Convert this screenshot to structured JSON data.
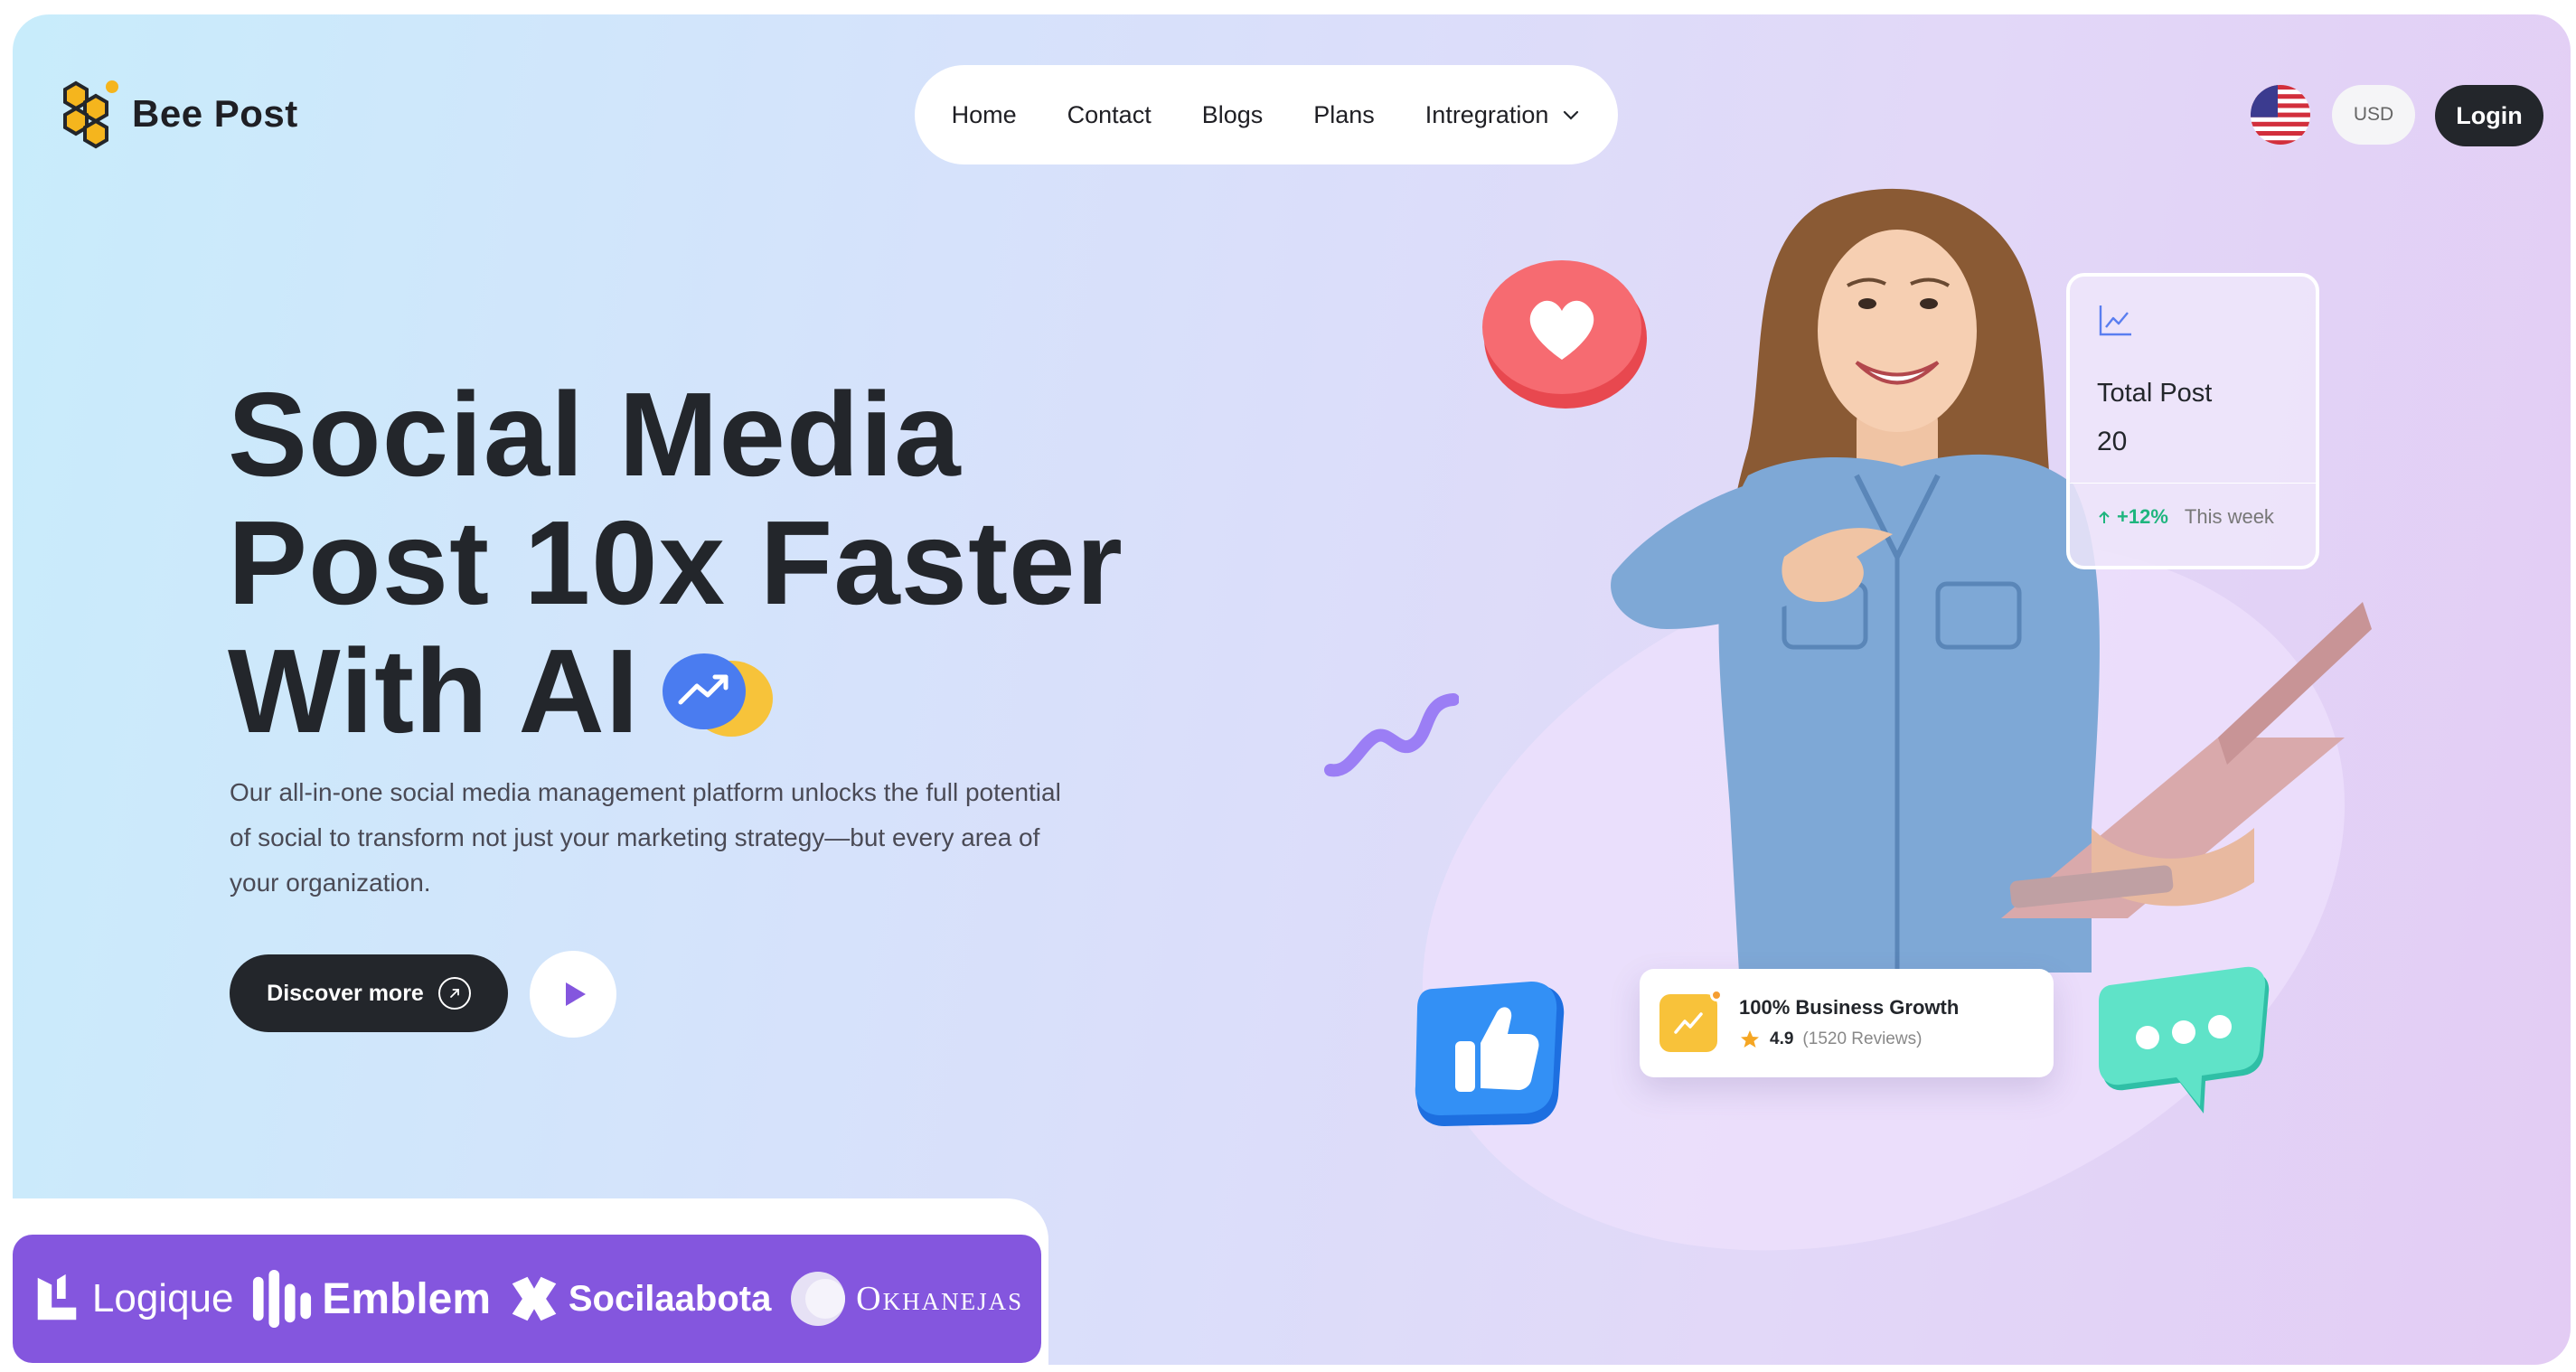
{
  "brand": {
    "name": "Bee Post",
    "colors": {
      "accent_purple": "#8456de",
      "dark": "#23262b",
      "honey": "#f5b51d",
      "growth_green": "#1fb57e"
    }
  },
  "nav": {
    "items": [
      {
        "label": "Home"
      },
      {
        "label": "Contact"
      },
      {
        "label": "Blogs"
      },
      {
        "label": "Plans"
      },
      {
        "label": "Intregration",
        "has_dropdown": true
      }
    ]
  },
  "header": {
    "flag_icon": "us-flag-icon",
    "currency": "USD",
    "login_label": "Login"
  },
  "hero": {
    "headline_lines": [
      "Social Media",
      "Post 10x Faster",
      "With AI"
    ],
    "description": "Our all-in-one social media management platform unlocks the full potential of social to transform not just your marketing strategy—but every area of your organization.",
    "cta_label": "Discover more",
    "play_icon": "play-icon"
  },
  "stat_card": {
    "label": "Total Post",
    "value": "20",
    "change": "+12%",
    "period": "This week"
  },
  "growth_card": {
    "title": "100% Business Growth",
    "rating": "4.9",
    "reviews": "(1520 Reviews)"
  },
  "partners": [
    {
      "name": "Logique",
      "icon": "logique-logo"
    },
    {
      "name": "Emblem",
      "icon": "emblem-logo"
    },
    {
      "name": "Socilaabota",
      "icon": "socilaabota-logo"
    },
    {
      "name": "Okhanejas",
      "icon": "okhanejas-logo"
    }
  ]
}
